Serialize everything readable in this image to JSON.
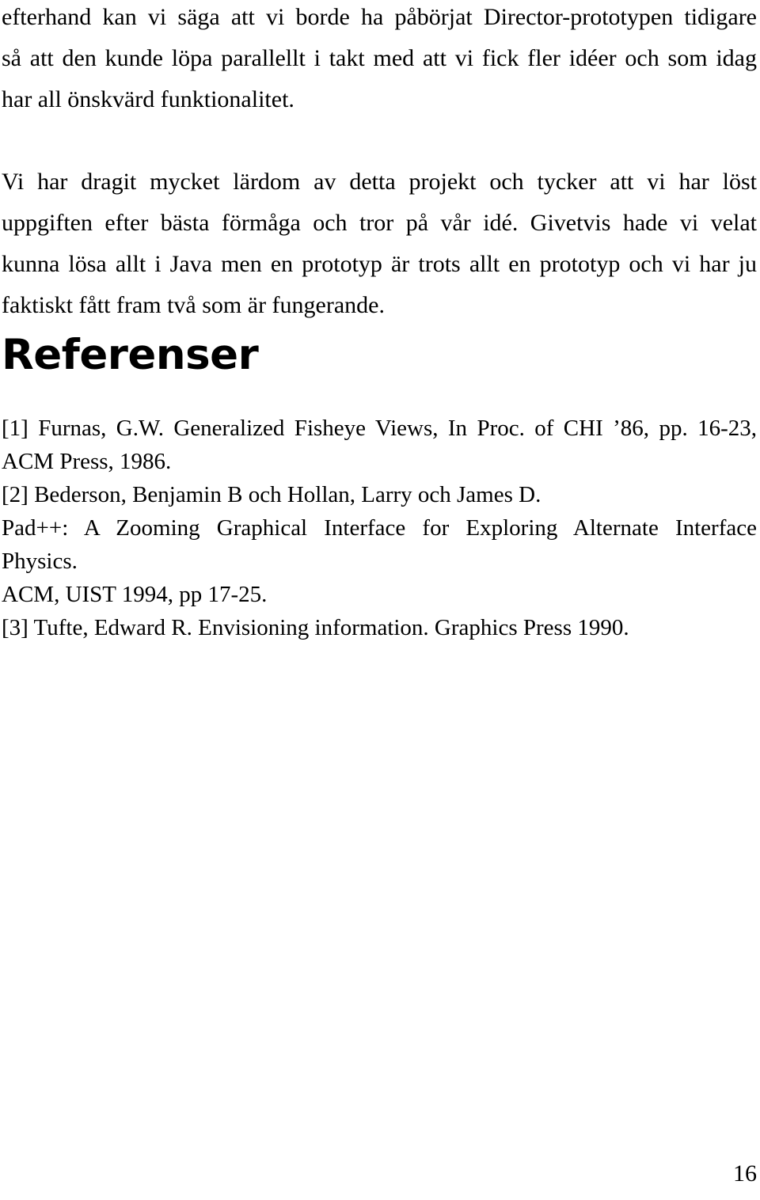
{
  "document": {
    "language": "sv",
    "page_number": "16",
    "background_color": "#ffffff",
    "text_color": "#000000"
  },
  "body": {
    "paragraphs": [
      {
        "name": "paragraph-efterhand",
        "lines": [
          "efterhand kan vi säga att vi borde ha påbörjat Director-prototypen tidigare",
          "så att den kunde löpa parallellt i takt med att vi fick fler idéer och som idag",
          "har all önskvärd funktionalitet."
        ],
        "full_text": "efterhand kan vi säga att vi borde ha påbörjat Director-prototypen tidigare så att den kunde löpa parallellt i takt med att vi fick fler idéer och som idag har all önskvärd funktionalitet."
      },
      {
        "name": "paragraph-lardom",
        "lines": [
          "Vi har dragit mycket lärdom av detta projekt och tycker att vi har löst",
          "uppgiften efter bästa förmåga och tror på vår idé. Givetvis hade vi velat",
          "kunna lösa allt i Java men en prototyp är trots allt en prototyp och vi har ju",
          "faktiskt fått fram två som är fungerande."
        ],
        "full_text": "Vi har dragit mycket lärdom av detta projekt och tycker att vi har löst uppgiften efter bästa förmåga och tror på vår idé. Givetvis hade vi velat kunna lösa allt i Java men en prototyp är trots allt en prototyp och vi har ju faktiskt fått fram två som är fungerande."
      }
    ]
  },
  "references_section": {
    "heading": "Referenser",
    "entries": [
      {
        "marker": "[1]",
        "lines": [
          "[1] Furnas, G.W. Generalized Fisheye Views, In Proc. of CHI ’86, pp. 16-23,",
          "ACM Press, 1986."
        ],
        "full_text": "[1] Furnas, G.W. Generalized Fisheye Views, In Proc. of CHI ’86, pp. 16-23, ACM Press, 1986."
      },
      {
        "marker": "[2]",
        "lines": [
          "[2]  Bederson, Benjamin B och Hollan, Larry och James D.",
          "Pad++: A Zooming Graphical Interface for Exploring Alternate Interface",
          "Physics.",
          "ACM, UIST 1994, pp 17-25."
        ],
        "full_text": "[2]  Bederson, Benjamin B och Hollan, Larry och James D. Pad++: A Zooming Graphical Interface for Exploring Alternate Interface Physics. ACM, UIST 1994, pp 17-25."
      },
      {
        "marker": "[3]",
        "lines": [
          "[3]  Tufte, Edward R. Envisioning information. Graphics Press 1990."
        ],
        "full_text": "[3]  Tufte, Edward R. Envisioning information. Graphics Press 1990."
      }
    ]
  }
}
